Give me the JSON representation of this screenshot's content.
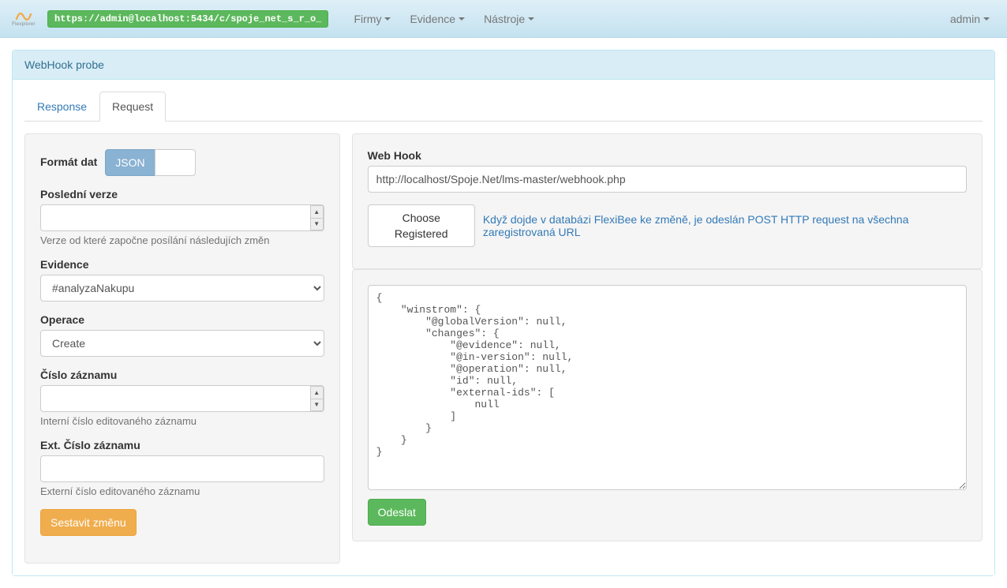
{
  "nav": {
    "url_badge": "https://admin@localhost:5434/c/spoje_net_s_r_o_",
    "menu": [
      "Firmy",
      "Evidence",
      "Nástroje"
    ],
    "user": "admin"
  },
  "panel": {
    "title": "WebHook probe"
  },
  "tabs": {
    "response": "Response",
    "request": "Request"
  },
  "left": {
    "format_label": "Formát dat",
    "format_options": {
      "json": "JSON",
      "xml_placeholder": " "
    },
    "version_label": "Poslední verze",
    "version_help": "Verze od které započne posílání následujích změn",
    "evidence_label": "Evidence",
    "evidence_value": "#analyzaNakupu",
    "operation_label": "Operace",
    "operation_value": "Create",
    "recid_label": "Číslo záznamu",
    "recid_help": "Interní číslo editovaného záznamu",
    "extid_label": "Ext. Číslo záznamu",
    "extid_help": "Externí číslo editovaného záznamu",
    "build_button": "Sestavit změnu"
  },
  "right": {
    "webhook_label": "Web Hook",
    "webhook_value": "http://localhost/Spoje.Net/lms-master/webhook.php",
    "choose_button": "Choose Registered",
    "hook_desc": "Když dojde v databázi FlexiBee ke změně, je odeslán POST HTTP request na všechna zaregistrovaná URL",
    "json_body": "{\n    \"winstrom\": {\n        \"@globalVersion\": null,\n        \"changes\": {\n            \"@evidence\": null,\n            \"@in-version\": null,\n            \"@operation\": null,\n            \"id\": null,\n            \"external-ids\": [\n                null\n            ]\n        }\n    }\n}",
    "send_button": "Odeslat"
  }
}
